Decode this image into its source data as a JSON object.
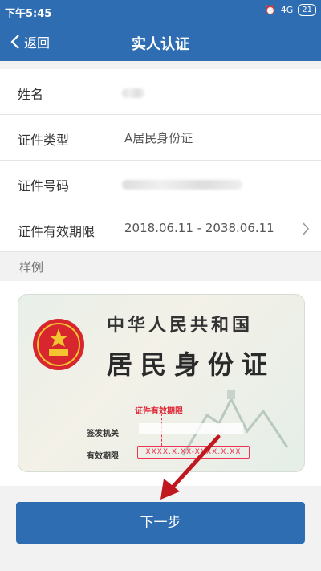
{
  "status": {
    "time": "下午5:45",
    "network": "4G",
    "battery": "21"
  },
  "nav": {
    "back_label": "返回",
    "title": "实人认证"
  },
  "form": {
    "rows": [
      {
        "label": "姓名",
        "value": ""
      },
      {
        "label": "证件类型",
        "value": "A居民身份证"
      },
      {
        "label": "证件号码",
        "value": ""
      },
      {
        "label": "证件有效期限",
        "value": "2018.06.11 - 2038.06.11"
      }
    ]
  },
  "sample": {
    "section_label": "样例",
    "card_title_line1": "中华人民共和国",
    "card_title_line2": "居民身份证",
    "valid_period_tag": "证件有效期限",
    "issuer_label": "签发机关",
    "validity_label": "有效期限",
    "validity_placeholder": "XXXX.X.XX-XXXX.X.XX"
  },
  "actions": {
    "next_label": "下一步"
  },
  "colors": {
    "primary": "#2f6db3",
    "highlight": "#dd2233"
  }
}
